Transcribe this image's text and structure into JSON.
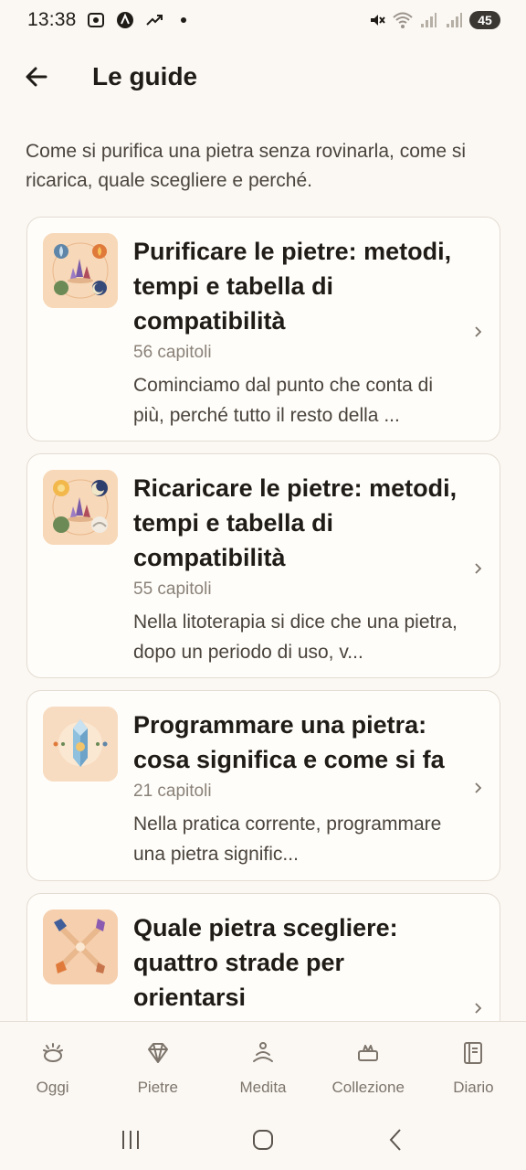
{
  "status_bar": {
    "time": "13:38",
    "battery": "45",
    "icons": [
      "screenshot-icon",
      "app-a-icon",
      "trending-icon",
      "dot-icon",
      "mute-icon",
      "wifi-icon",
      "signal-icon",
      "signal-icon"
    ]
  },
  "header": {
    "back_icon": "arrow-left-icon",
    "title": "Le guide"
  },
  "intro": "Come si purifica una pietra senza rovinarla, come si ricarica, quale scegliere e perché.",
  "guides": [
    {
      "title": "Purificare le pietre: metodi, tempi e tabella di compatibilità",
      "count": "56 capitoli",
      "description": "Cominciamo dal punto che conta di più, perché tutto il resto della ..."
    },
    {
      "title": "Ricaricare le pietre: metodi, tempi e tabella di compatibilità",
      "count": "55 capitoli",
      "description": "Nella litoterapia si dice che una pietra, dopo un periodo di uso, v..."
    },
    {
      "title": "Programmare una pietra: cosa significa e come si fa",
      "count": "21 capitoli",
      "description": "Nella pratica corrente, programmare una pietra signific..."
    },
    {
      "title": "Quale pietra scegliere: quattro strade per orientarsi",
      "count": "",
      "description": ""
    }
  ],
  "bottom_nav": [
    {
      "label": "Oggi",
      "icon": "sunrise-icon"
    },
    {
      "label": "Pietre",
      "icon": "gem-icon"
    },
    {
      "label": "Medita",
      "icon": "meditation-icon"
    },
    {
      "label": "Collezione",
      "icon": "collection-icon"
    },
    {
      "label": "Diario",
      "icon": "journal-icon"
    }
  ],
  "colors": {
    "background": "#fbf8f3",
    "card": "#fffdf9",
    "border": "#e3dcd2",
    "text": "#1f1b16",
    "muted": "#8a8279"
  }
}
